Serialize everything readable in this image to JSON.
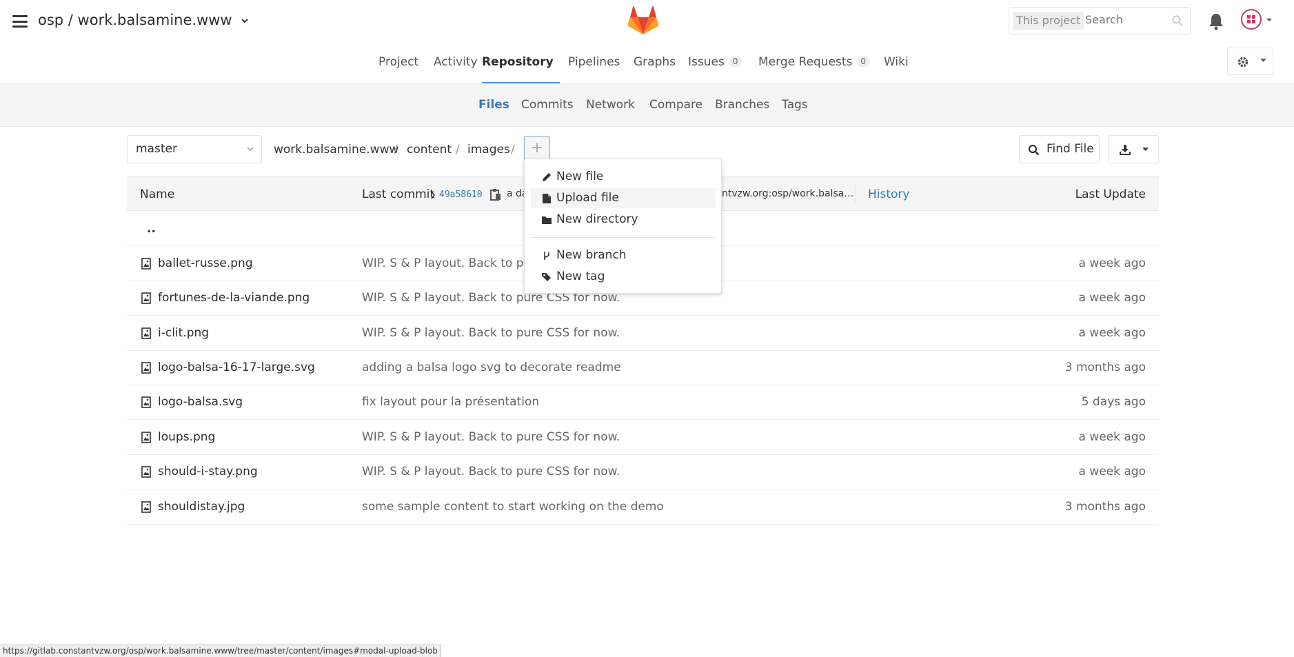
{
  "header": {
    "project_title": "osp / work.balsamine.www",
    "search": {
      "scope": "This project",
      "placeholder": "Search"
    }
  },
  "nav": {
    "items": [
      {
        "label": "Project"
      },
      {
        "label": "Activity"
      },
      {
        "label": "Repository",
        "active": true
      },
      {
        "label": "Pipelines"
      },
      {
        "label": "Graphs"
      },
      {
        "label": "Issues",
        "count": "0"
      },
      {
        "label": "Merge Requests",
        "count": "0"
      },
      {
        "label": "Wiki"
      }
    ]
  },
  "subnav": {
    "items": [
      {
        "label": "Files",
        "active": true
      },
      {
        "label": "Commits"
      },
      {
        "label": "Network"
      },
      {
        "label": "Compare"
      },
      {
        "label": "Branches"
      },
      {
        "label": "Tags"
      }
    ]
  },
  "repo": {
    "branch": "master",
    "breadcrumb": [
      "work.balsamine.www",
      "content",
      "images"
    ],
    "add_label": "+",
    "find_file_label": "Find File"
  },
  "table": {
    "headers": {
      "name": "Name",
      "last_commit": "Last commit",
      "last_update": "Last Update",
      "history": "History"
    },
    "last_commit_sha": "49a58610",
    "last_commit_msg_head": "a da",
    "last_commit_msg_tail": "ntvzw.org:osp/work.balsa…",
    "parent_dir": "..",
    "rows": [
      {
        "name": "ballet-russe.png",
        "message": "WIP. S & P layout. Back to pure",
        "date": "a week ago"
      },
      {
        "name": "fortunes-de-la-viande.png",
        "message": "WIP. S & P layout. Back to pure CSS for now.",
        "date": "a week ago"
      },
      {
        "name": "i-clit.png",
        "message": "WIP. S & P layout. Back to pure CSS for now.",
        "date": "a week ago"
      },
      {
        "name": "logo-balsa-16-17-large.svg",
        "message": "adding a balsa logo svg to decorate readme",
        "date": "3 months ago"
      },
      {
        "name": "logo-balsa.svg",
        "message": "fix layout pour la présentation",
        "date": "5 days ago"
      },
      {
        "name": "loups.png",
        "message": "WIP. S & P layout. Back to pure CSS for now.",
        "date": "a week ago"
      },
      {
        "name": "should-i-stay.png",
        "message": "WIP. S & P layout. Back to pure CSS for now.",
        "date": "a week ago"
      },
      {
        "name": "shouldistay.jpg",
        "message": "some sample content to start working on the demo",
        "date": "3 months ago"
      }
    ]
  },
  "dropdown": {
    "items": [
      {
        "label": "New file",
        "icon": "pencil-icon"
      },
      {
        "label": "Upload file",
        "icon": "file-icon"
      },
      {
        "label": "New directory",
        "icon": "folder-icon"
      },
      {
        "label": "New branch",
        "icon": "branch-icon"
      },
      {
        "label": "New tag",
        "icon": "tags-icon"
      }
    ]
  },
  "statusbar": {
    "url": "https://gitlab.constantvzw.org/osp/work.balsamine.www/tree/master/content/images#modal-upload-blob"
  },
  "colors": {
    "accent": "#3777b0",
    "active_underline": "#4a8bee",
    "logo": "#fc6d26"
  }
}
